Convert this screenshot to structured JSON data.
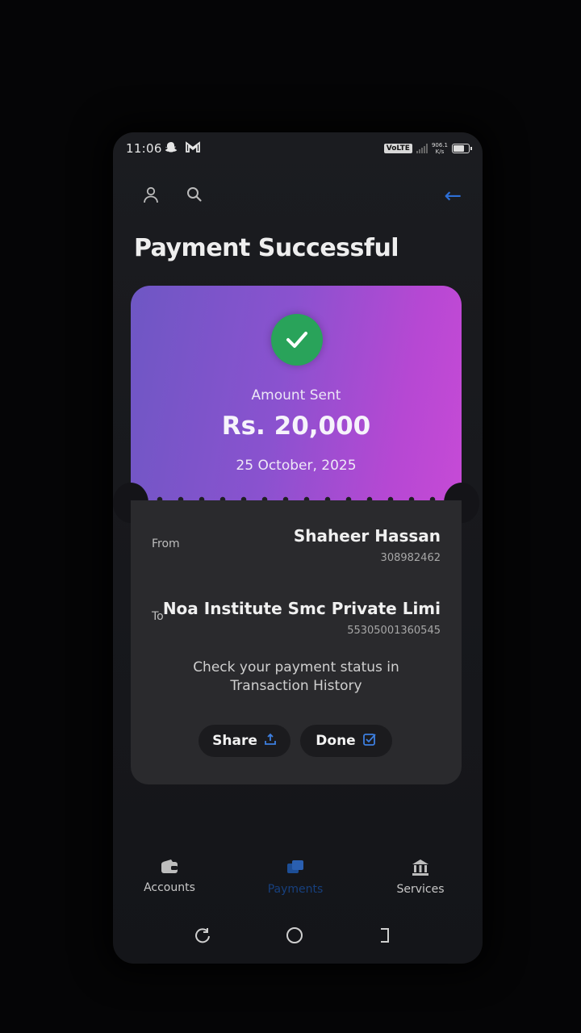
{
  "status_bar": {
    "time": "11:06",
    "network": "VoLTE",
    "speed_value": "906.1",
    "speed_unit": "K/s"
  },
  "header": {
    "title": "Payment Successful"
  },
  "receipt": {
    "amount_label": "Amount Sent",
    "amount": "Rs. 20,000",
    "date": "25 October, 2025",
    "from_label": "From",
    "from_name": "Shaheer Hassan",
    "from_account": "308982462",
    "to_label": "To",
    "to_name": "Noa Institute Smc Private Limi",
    "to_account": "55305001360545",
    "hint": "Check your payment status in Transaction History"
  },
  "actions": {
    "share_label": "Share",
    "done_label": "Done"
  },
  "bottom_nav": {
    "items": [
      {
        "label": "Accounts",
        "icon": "wallet-icon"
      },
      {
        "label": "Payments",
        "icon": "payments-icon",
        "active": true
      },
      {
        "label": "Services",
        "icon": "bank-icon"
      }
    ]
  },
  "colors": {
    "accent": "#2d6fd6",
    "success": "#29a35a",
    "card_gradient_start": "#6e57c4",
    "card_gradient_end": "#c64ad6"
  }
}
